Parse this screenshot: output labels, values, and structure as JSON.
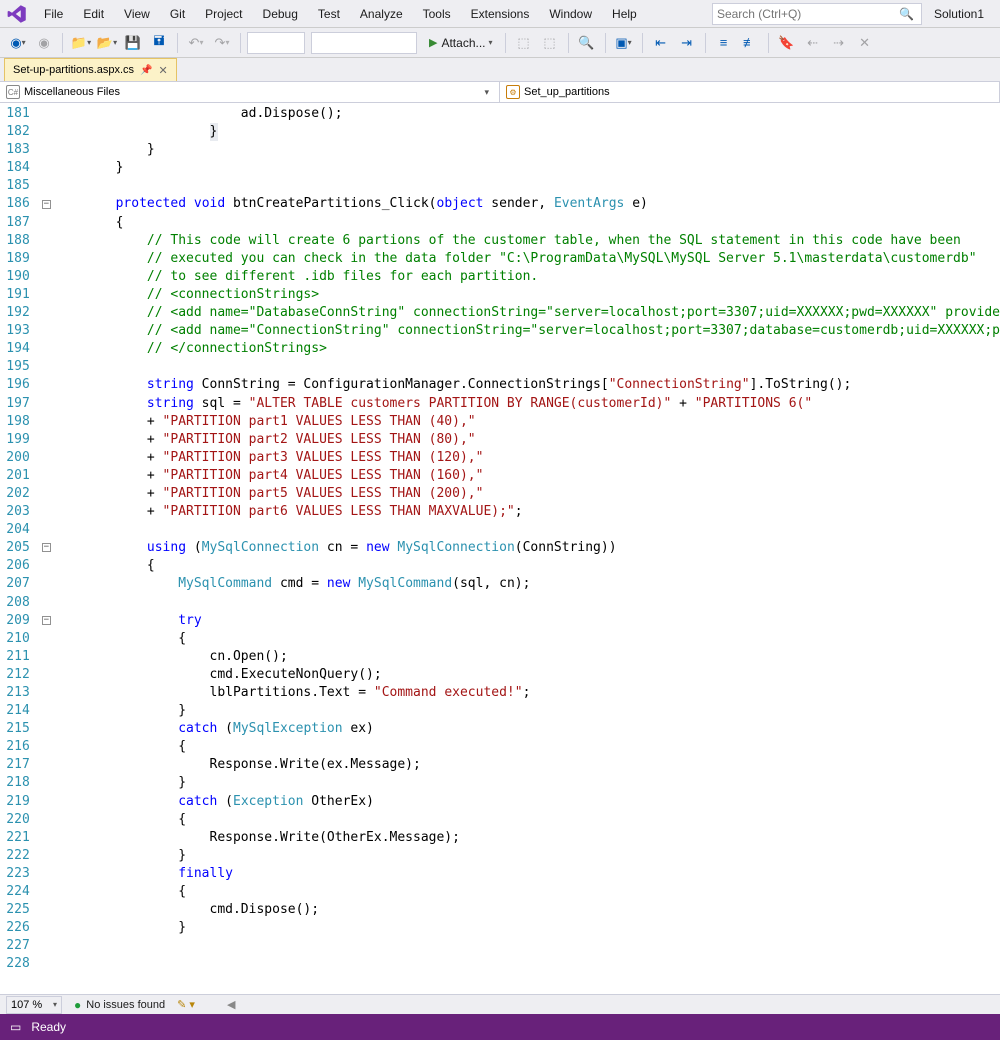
{
  "menubar": {
    "items": [
      "File",
      "Edit",
      "View",
      "Git",
      "Project",
      "Debug",
      "Test",
      "Analyze",
      "Tools",
      "Extensions",
      "Window",
      "Help"
    ],
    "search_placeholder": "Search (Ctrl+Q)",
    "solution": "Solution1"
  },
  "toolbar": {
    "attach_label": "Attach..."
  },
  "tab": {
    "filename": "Set-up-partitions.aspx.cs",
    "pinned_icon": "pin-icon",
    "close_icon": "close-icon"
  },
  "nav": {
    "left": "Miscellaneous Files",
    "right": "Set_up_partitions"
  },
  "gutter": {
    "start": 181,
    "end": 228
  },
  "code_lines": [
    "                        ad.Dispose();",
    "                    }",
    "            }",
    "        }",
    "",
    "        protected void btnCreatePartitions_Click(object sender, EventArgs e)",
    "        {",
    "            // This code will create 6 partions of the customer table, when the SQL statement in this code have been",
    "            // executed you can check in the data folder \"C:\\ProgramData\\MySQL\\MySQL Server 5.1\\masterdata\\customerdb\"",
    "            // to see different .idb files for each partition.",
    "            // <connectionStrings>",
    "            // <add name=\"DatabaseConnString\" connectionString=\"server=localhost;port=3307;uid=XXXXXX;pwd=XXXXXX\" provide",
    "            // <add name=\"ConnectionString\" connectionString=\"server=localhost;port=3307;database=customerdb;uid=XXXXXX;p",
    "            // </connectionStrings>",
    "",
    "            string ConnString = ConfigurationManager.ConnectionStrings[\"ConnectionString\"].ToString();",
    "            string sql = \"ALTER TABLE customers PARTITION BY RANGE(customerId)\" + \"PARTITIONS 6(\"",
    "            + \"PARTITION part1 VALUES LESS THAN (40),\"",
    "            + \"PARTITION part2 VALUES LESS THAN (80),\"",
    "            + \"PARTITION part3 VALUES LESS THAN (120),\"",
    "            + \"PARTITION part4 VALUES LESS THAN (160),\"",
    "            + \"PARTITION part5 VALUES LESS THAN (200),\"",
    "            + \"PARTITION part6 VALUES LESS THAN MAXVALUE);\";",
    "",
    "            using (MySqlConnection cn = new MySqlConnection(ConnString))",
    "            {",
    "                MySqlCommand cmd = new MySqlCommand(sql, cn);",
    "",
    "                try",
    "                {",
    "                    cn.Open();",
    "                    cmd.ExecuteNonQuery();",
    "                    lblPartitions.Text = \"Command executed!\";",
    "                }",
    "                catch (MySqlException ex)",
    "                {",
    "                    Response.Write(ex.Message);",
    "                }",
    "                catch (Exception OtherEx)",
    "                {",
    "                    Response.Write(OtherEx.Message);",
    "                }",
    "                finally",
    "                {",
    "                    cmd.Dispose();",
    "                }"
  ],
  "zoombar": {
    "zoom": "107 %",
    "issues": "No issues found"
  },
  "statusbar": {
    "status": "Ready"
  }
}
